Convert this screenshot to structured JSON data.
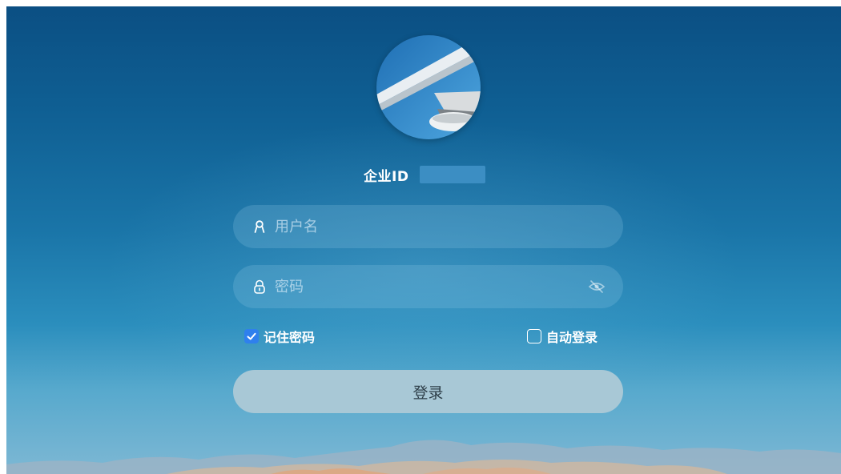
{
  "company": {
    "label": "企业ID",
    "value": ""
  },
  "username": {
    "placeholder": "用户名",
    "value": ""
  },
  "password": {
    "placeholder": "密码",
    "value": ""
  },
  "options": {
    "remember_label": "记住密码",
    "remember_checked": true,
    "auto_login_label": "自动登录",
    "auto_login_checked": false
  },
  "login_button": {
    "label": "登录"
  },
  "icons": {
    "username": "user-icon",
    "password": "lock-icon",
    "toggle_visibility": "eye-off-icon",
    "avatar": "airplane-wing-photo"
  },
  "colors": {
    "background_top": "#0b4f83",
    "background_bottom": "#7eb8d4",
    "checkbox_checked": "#2f80ed",
    "login_button_bg": "#a8c8d6"
  }
}
